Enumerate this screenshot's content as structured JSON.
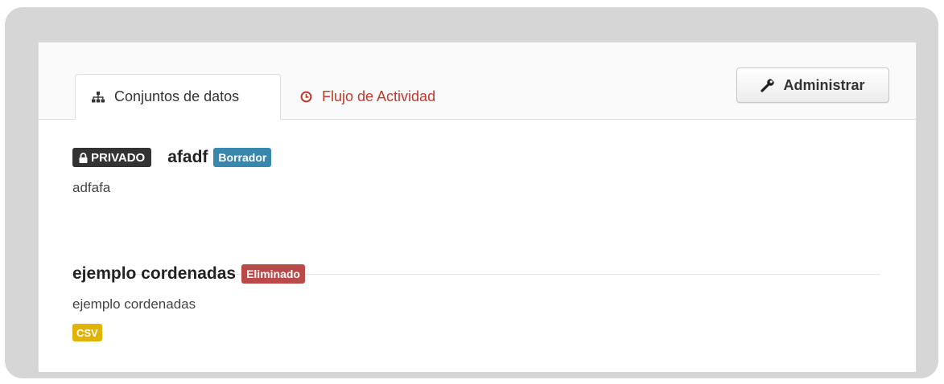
{
  "tabs": [
    {
      "label": "Conjuntos de datos",
      "icon": "sitemap-icon",
      "active": true
    },
    {
      "label": "Flujo de Actividad",
      "icon": "clock-icon",
      "active": false
    }
  ],
  "manage_button": {
    "label": "Administrar",
    "icon": "wrench-icon"
  },
  "datasets": [
    {
      "private_label": "PRIVADO",
      "title": "afadf",
      "state_label": "Borrador",
      "notes": "adfafa",
      "formats": []
    },
    {
      "private_label": "",
      "title": "ejemplo cordenadas",
      "state_label": "Eliminado",
      "notes": "ejemplo cordenadas",
      "formats": [
        "CSV"
      ]
    }
  ],
  "colors": {
    "active_link": "#c0392b",
    "draft_badge": "#3a87ad",
    "deleted_badge": "#b94a48",
    "private_badge": "#333333",
    "csv_badge": "#e0b400"
  }
}
